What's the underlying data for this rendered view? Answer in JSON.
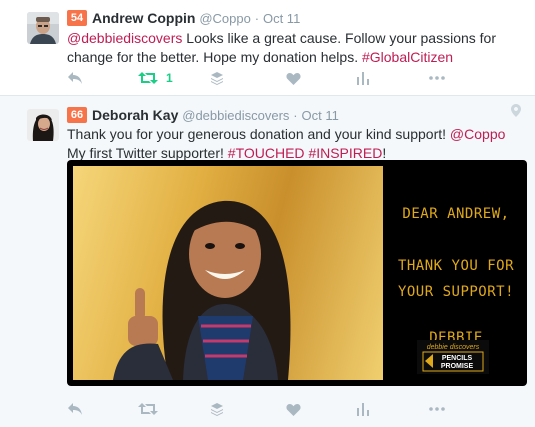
{
  "tweets": [
    {
      "badge": "54",
      "badge_color": "#f7734a",
      "name": "Andrew Coppin",
      "handle": "@Coppo",
      "separator": "·",
      "time": "Oct 11",
      "text_parts": [
        {
          "text": "@debbiediscovers",
          "link": true
        },
        {
          "text": " Looks like a great cause. Follow your passions for change for the better. Hope my donation helps. ",
          "link": false
        },
        {
          "text": "#GlobalCitizen",
          "link": true
        }
      ],
      "retweet_count": "1"
    },
    {
      "badge": "66",
      "badge_color": "#f7734a",
      "name": "Deborah Kay",
      "handle": "@debbiediscovers",
      "separator": "·",
      "time": "Oct 11",
      "text_parts": [
        {
          "text": "Thank you for your generous donation and your kind support! ",
          "link": false
        },
        {
          "text": "@Coppo",
          "link": true
        },
        {
          "text": " My first Twitter supporter! ",
          "link": false
        },
        {
          "text": "#TOUCHED",
          "link": true
        },
        {
          "text": " ",
          "link": false
        },
        {
          "text": "#INSPIRED",
          "link": true
        },
        {
          "text": "!",
          "link": false
        }
      ],
      "image_text": {
        "line1": "DEAR ANDREW,",
        "line2": "THANK YOU FOR",
        "line3": "YOUR SUPPORT!",
        "signature": "DEBBIE",
        "logo_top": "debbie discovers",
        "logo_bottom": "PENCILS PROMISE"
      }
    }
  ],
  "icons": {
    "reply": "reply-icon",
    "retweet": "retweet-icon",
    "buffer": "buffer-icon",
    "like": "heart-icon",
    "analytics": "analytics-icon",
    "more": "more-icon",
    "location": "location-pin-icon"
  },
  "colors": {
    "link": "#bf1d53",
    "retweet_active": "#19cf86",
    "icon": "#aab8c2",
    "meta": "#8899a6",
    "note_text": "#e0a91a"
  }
}
